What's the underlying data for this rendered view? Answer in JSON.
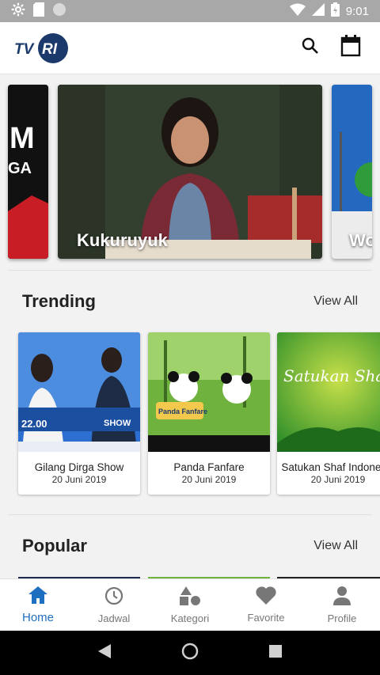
{
  "status_bar": {
    "time": "9:01"
  },
  "app_bar": {
    "logo_text": "TVRI"
  },
  "carousel": {
    "slides": [
      {
        "label": "M\nGA"
      },
      {
        "label": "Kukuruyuk"
      },
      {
        "label": "Wo"
      }
    ]
  },
  "trending": {
    "title": "Trending",
    "view_all": "View All",
    "cards": [
      {
        "title": "Gilang Dirga Show",
        "date": "20 Juni 2019",
        "thumb_text": "22.00",
        "thumb_badge": "SHOW"
      },
      {
        "title": "Panda Fanfare",
        "date": "20 Juni 2019",
        "thumb_text": "Panda Fanfare"
      },
      {
        "title": "Satukan Shaf Indonesia",
        "date": "20 Juni 2019",
        "thumb_text": "Satukan Shaf Indonesia"
      }
    ]
  },
  "popular": {
    "title": "Popular",
    "view_all": "View All"
  },
  "bottom_nav": {
    "items": [
      {
        "label": "Home",
        "icon": "home-icon",
        "active": true
      },
      {
        "label": "Jadwal",
        "icon": "clock-icon"
      },
      {
        "label": "Kategori",
        "icon": "shapes-icon"
      },
      {
        "label": "Favorite",
        "icon": "heart-icon"
      },
      {
        "label": "Profile",
        "icon": "person-icon"
      }
    ]
  },
  "colors": {
    "accent": "#1f6fc1",
    "logo_navy": "#1b3a6b"
  }
}
